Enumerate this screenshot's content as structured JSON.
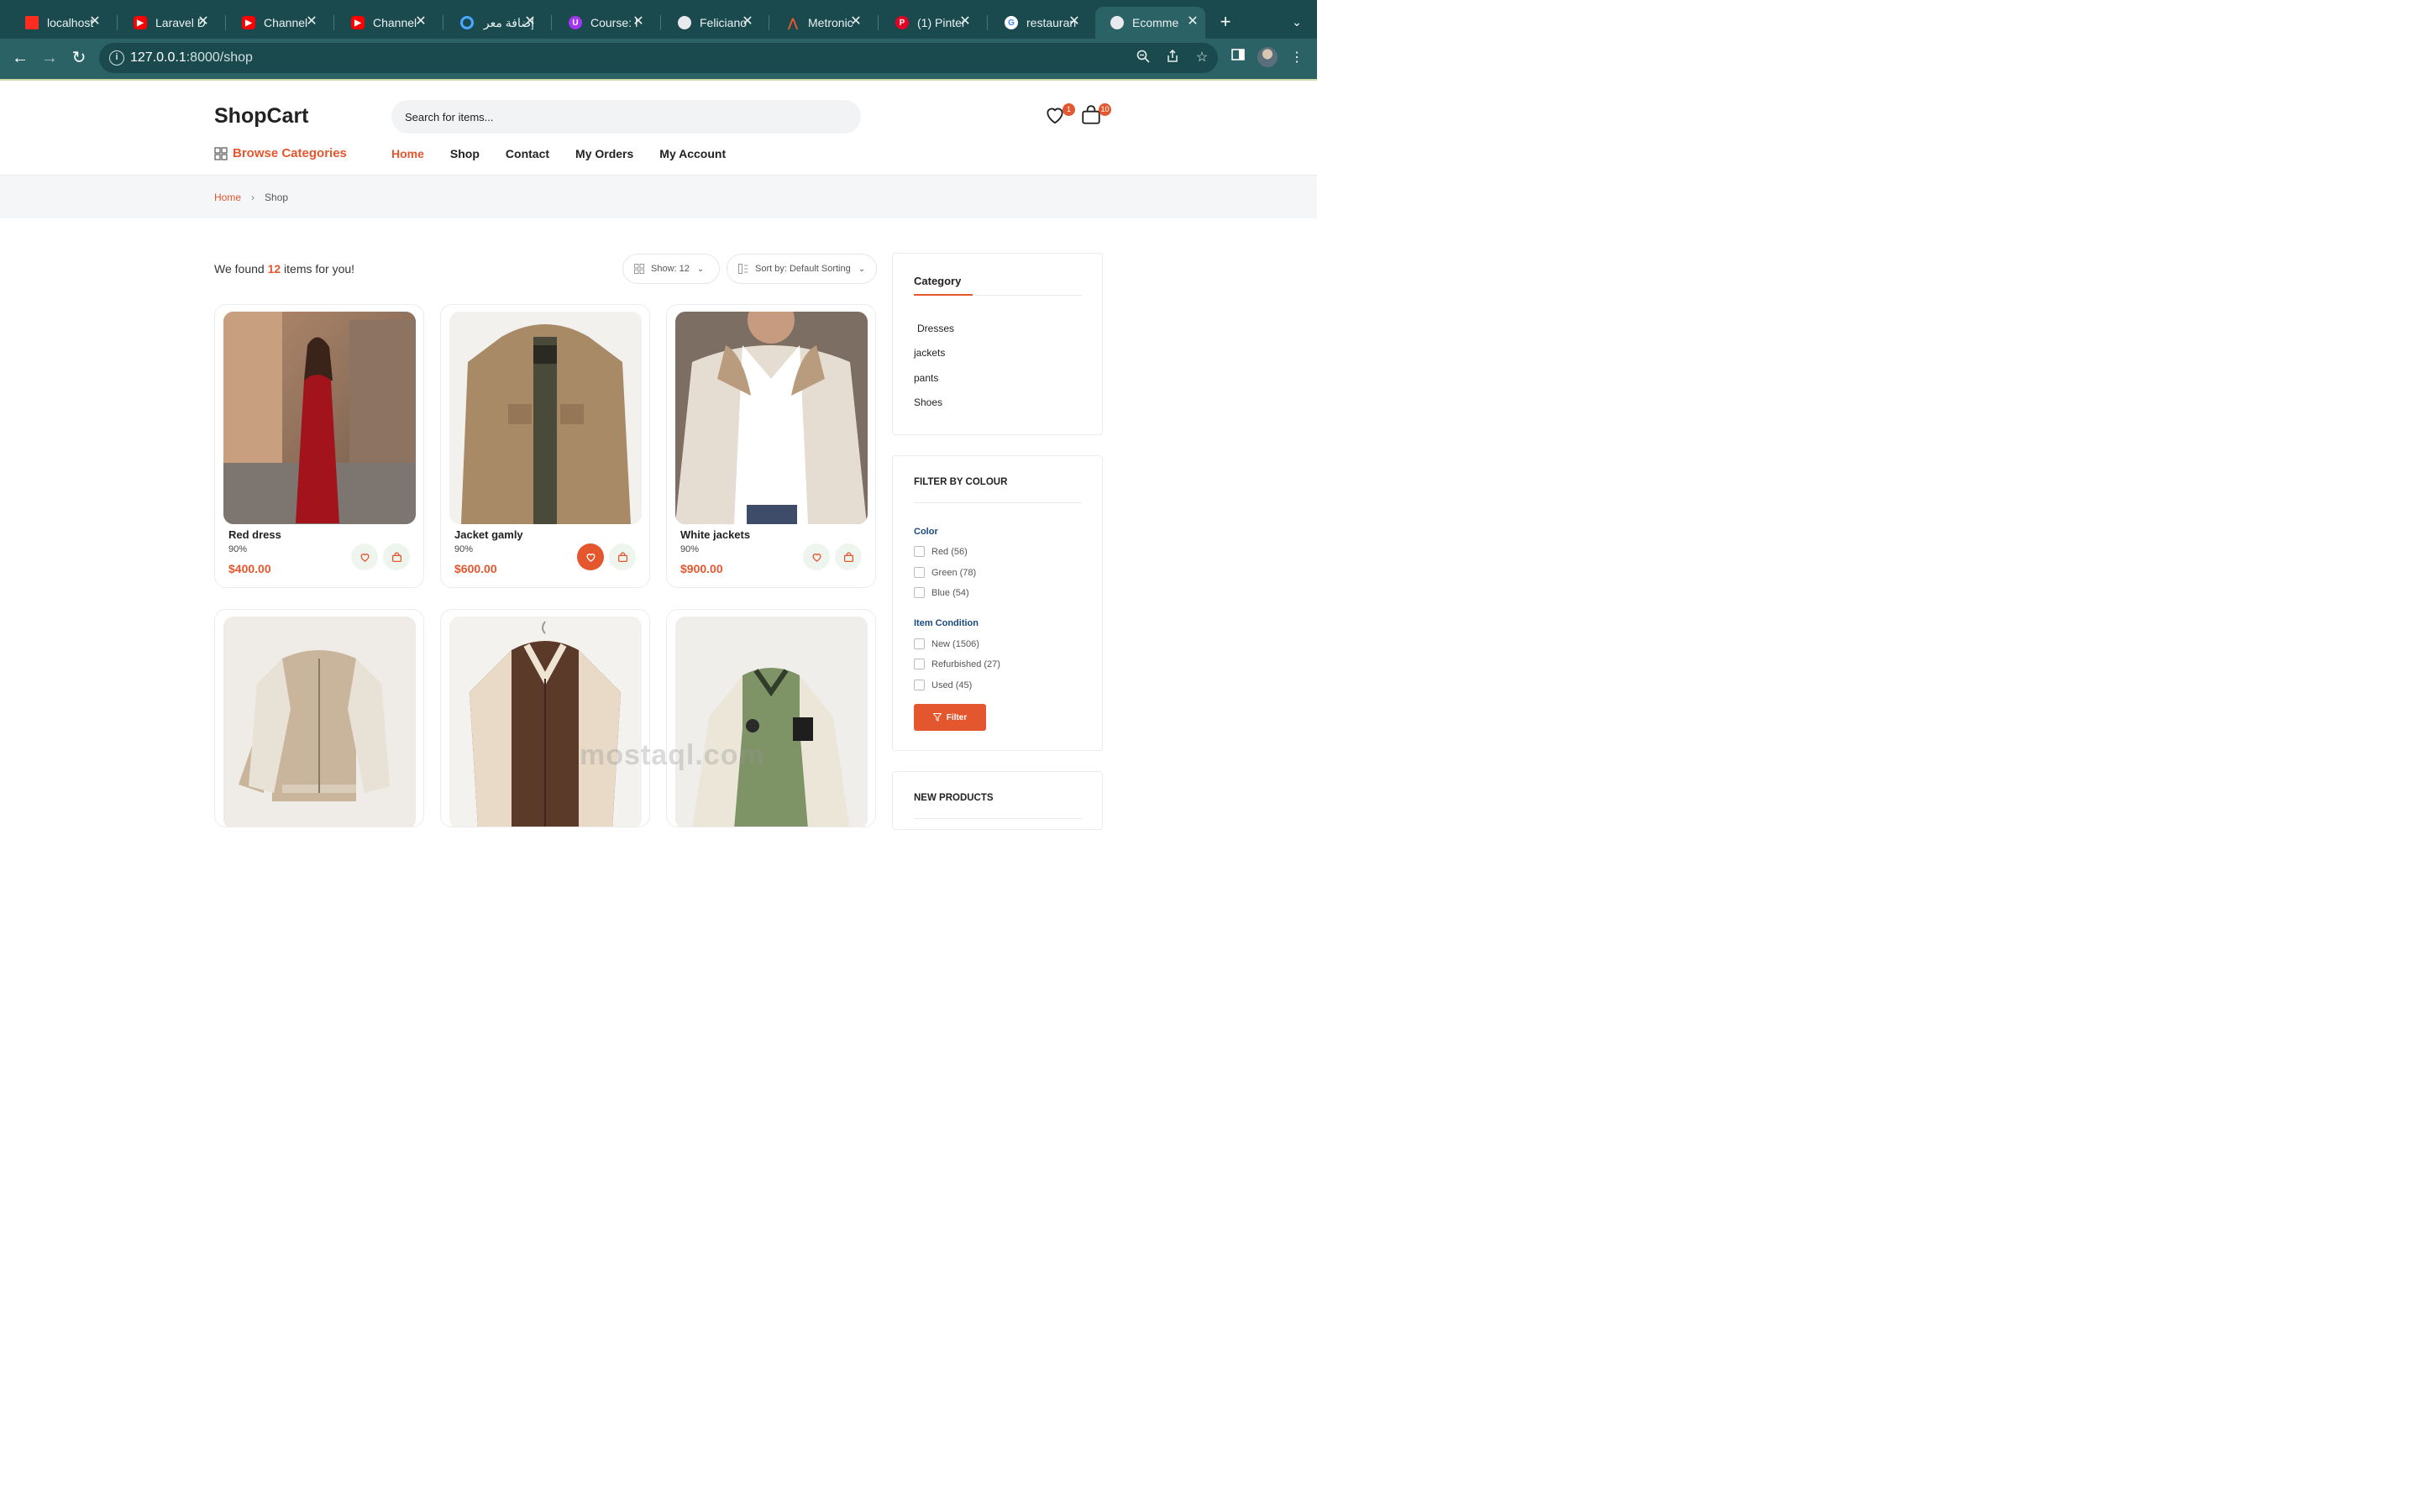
{
  "browser": {
    "tabs": [
      {
        "label": "localhost",
        "icon": "laravel-icon"
      },
      {
        "label": "Laravel D",
        "icon": "youtube-icon"
      },
      {
        "label": "Channel",
        "icon": "youtube-icon"
      },
      {
        "label": "Channel",
        "icon": "youtube-icon"
      },
      {
        "label": "إضافة معر",
        "icon": "circle-icon"
      },
      {
        "label": "Course: I",
        "icon": "udemy-icon"
      },
      {
        "label": "Feliciano",
        "icon": "globe-icon"
      },
      {
        "label": "Metronic",
        "icon": "metronic-icon"
      },
      {
        "label": "(1) Pinter",
        "icon": "pinterest-icon"
      },
      {
        "label": "restauran",
        "icon": "google-icon"
      },
      {
        "label": "Ecomme",
        "icon": "globe-icon"
      }
    ],
    "url_host": "127.0.0.1",
    "url_rest": ":8000/shop",
    "accent": "#2a6266"
  },
  "header": {
    "logo": "ShopCart",
    "search_placeholder": "Search for items...",
    "wishlist_count": "1",
    "cart_count": "10",
    "browse_label": "Browse Categories",
    "nav": [
      "Home",
      "Shop",
      "Contact",
      "My Orders",
      "My Account"
    ],
    "accent_color": "#e4572e"
  },
  "breadcrumb": {
    "home": "Home",
    "separator": "›",
    "current": "Shop"
  },
  "listing": {
    "found_prefix": "We found",
    "found_count": "12",
    "found_suffix": "items for you!",
    "show_label": "Show:",
    "show_value": "12",
    "sort_label": "Sort by:",
    "sort_value": "Default Sorting"
  },
  "products": [
    {
      "name": "Red dress",
      "discount": "90%",
      "price": "$400.00"
    },
    {
      "name": "Jacket gamly",
      "discount": "90%",
      "price": "$600.00"
    },
    {
      "name": "White jackets",
      "discount": "90%",
      "price": "$900.00"
    },
    {
      "name": "",
      "discount": "",
      "price": ""
    },
    {
      "name": "",
      "discount": "",
      "price": ""
    },
    {
      "name": "",
      "discount": "",
      "price": ""
    }
  ],
  "sidebar": {
    "category_title": "Category",
    "categories": [
      "Dresses",
      "jackets",
      "pants",
      "Shoes"
    ],
    "filter_title": "FILTER BY COLOUR",
    "color_heading": "Color",
    "colors": [
      "Red (56)",
      "Green (78)",
      "Blue (54)"
    ],
    "condition_heading": "Item Condition",
    "conditions": [
      "New (1506)",
      "Refurbished (27)",
      "Used (45)"
    ],
    "filter_button": "Filter",
    "new_products_title": "NEW PRODUCTS"
  },
  "watermark": "mostaql.com"
}
